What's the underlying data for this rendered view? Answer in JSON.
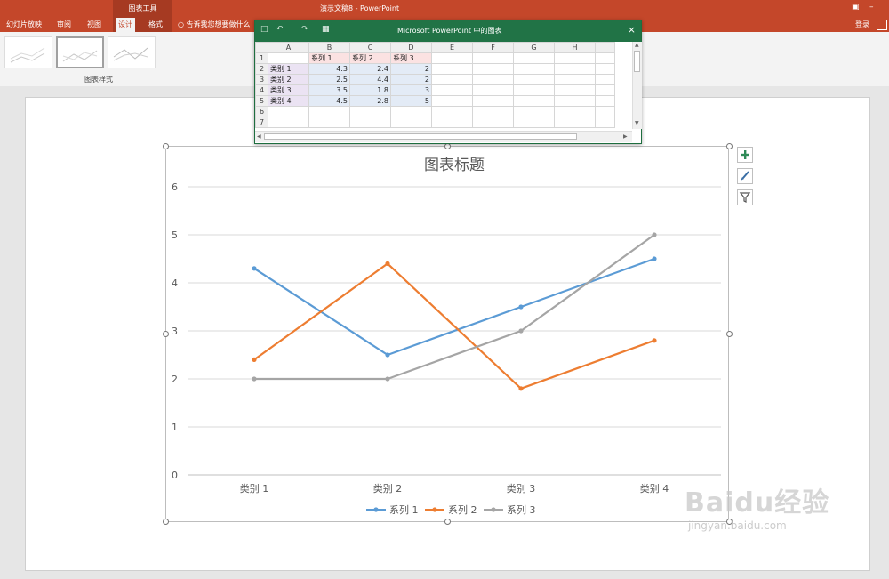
{
  "titlebar": {
    "context_tab": "图表工具",
    "doc_title": "演示文稿8 - PowerPoint"
  },
  "tabs": [
    "幻灯片放映",
    "审阅",
    "视图",
    "设计",
    "格式"
  ],
  "active_tab": "设计",
  "tell_me": "告诉我您想要做什么",
  "login": "登录",
  "ribbon": {
    "group_label": "图表样式"
  },
  "spreadsheet": {
    "title": "Microsoft PowerPoint 中的图表",
    "columns": [
      "A",
      "B",
      "C",
      "D",
      "E",
      "F",
      "G",
      "H",
      "I"
    ],
    "rows": [
      [
        "1",
        "",
        "系列 1",
        "系列 2",
        "系列 3"
      ],
      [
        "2",
        "类别 1",
        "4.3",
        "2.4",
        "2"
      ],
      [
        "3",
        "类别 2",
        "2.5",
        "4.4",
        "2"
      ],
      [
        "4",
        "类别 3",
        "3.5",
        "1.8",
        "3"
      ],
      [
        "5",
        "类别 4",
        "4.5",
        "2.8",
        "5"
      ],
      [
        "6",
        "",
        "",
        "",
        ""
      ],
      [
        "7",
        "",
        "",
        "",
        ""
      ]
    ]
  },
  "chart_data": {
    "type": "line",
    "title": "图表标题",
    "categories": [
      "类别 1",
      "类别 2",
      "类别 3",
      "类别 4"
    ],
    "series": [
      {
        "name": "系列 1",
        "values": [
          4.3,
          2.5,
          3.5,
          4.5
        ],
        "color": "#5b9bd5"
      },
      {
        "name": "系列 2",
        "values": [
          2.4,
          4.4,
          1.8,
          2.8
        ],
        "color": "#ed7d31"
      },
      {
        "name": "系列 3",
        "values": [
          2,
          2,
          3,
          5
        ],
        "color": "#a5a5a5"
      }
    ],
    "ylim": [
      0,
      6
    ],
    "yticks": [
      "0",
      "1",
      "2",
      "3",
      "4",
      "5",
      "6"
    ],
    "grid": true,
    "legend": "bottom"
  },
  "watermark": {
    "brand": "Baidu经验",
    "url": "jingyan.baidu.com"
  },
  "colors": {
    "ribbon": "#c4472a",
    "excel": "#217346"
  }
}
